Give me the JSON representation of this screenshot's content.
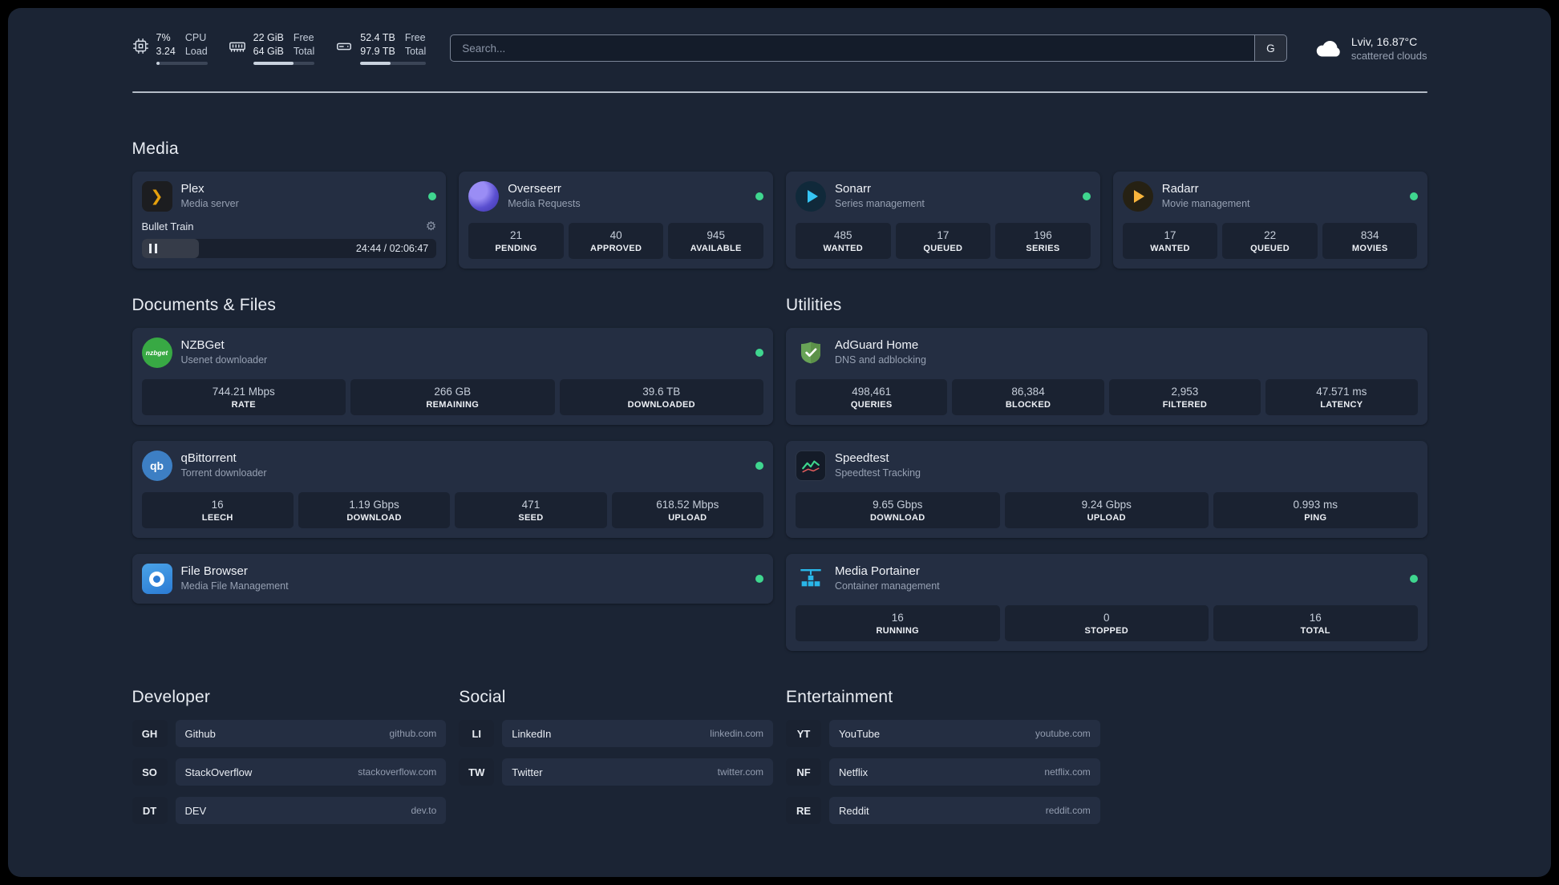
{
  "topbar": {
    "cpu": {
      "value1": "7%",
      "value2": "3.24",
      "label1": "CPU",
      "label2": "Load",
      "progress_pct": 7
    },
    "memory": {
      "value1": "22 GiB",
      "value2": "64 GiB",
      "label1": "Free",
      "label2": "Total",
      "progress_pct": 66
    },
    "disk": {
      "value1": "52.4 TB",
      "value2": "97.9 TB",
      "label1": "Free",
      "label2": "Total",
      "progress_pct": 46
    },
    "search": {
      "placeholder": "Search...",
      "provider_button": "G"
    },
    "weather": {
      "location": "Lviv, 16.87°C",
      "condition": "scattered clouds"
    }
  },
  "icons": {
    "cpu": "cpu-chip",
    "memory": "ram-stick",
    "disk": "hard-drive",
    "weather": "cloud",
    "settings": "gear",
    "playback": "pause",
    "plex": "plex-chevron",
    "overseerr": "overseerr-orb",
    "sonarr": "play-triangle-blue",
    "radarr": "play-triangle-yellow",
    "nzbget": "nzbget-badge",
    "qbittorrent": "qb-badge",
    "filebrowser": "filebrowser-disc",
    "adguard": "shield-check",
    "speedtest": "chart-line",
    "portainer": "container-crane"
  },
  "colors": {
    "online": "#3fd68f",
    "plex": "#e5a00d",
    "overseerr": "#5a4fd0",
    "sonarr": "#35c5f4",
    "radarr": "#f9b53c",
    "nzbget": "#38a944",
    "qbittorrent": "#3d7fc4",
    "filebrowser": "#2b7bd4",
    "adguard": "#68a357",
    "speedtest": "#3dd68c",
    "portainer": "#29b6e8"
  },
  "sections": {
    "media": {
      "title": "Media",
      "plex": {
        "name": "Plex",
        "subtitle": "Media server",
        "now_playing": {
          "title": "Bullet Train",
          "time": "24:44 / 02:06:47",
          "progress_pct": 19.5
        }
      },
      "overseerr": {
        "name": "Overseerr",
        "subtitle": "Media Requests",
        "stats": [
          {
            "value": "21",
            "label": "PENDING"
          },
          {
            "value": "40",
            "label": "APPROVED"
          },
          {
            "value": "945",
            "label": "AVAILABLE"
          }
        ]
      },
      "sonarr": {
        "name": "Sonarr",
        "subtitle": "Series management",
        "stats": [
          {
            "value": "485",
            "label": "WANTED"
          },
          {
            "value": "17",
            "label": "QUEUED"
          },
          {
            "value": "196",
            "label": "SERIES"
          }
        ]
      },
      "radarr": {
        "name": "Radarr",
        "subtitle": "Movie management",
        "stats": [
          {
            "value": "17",
            "label": "WANTED"
          },
          {
            "value": "22",
            "label": "QUEUED"
          },
          {
            "value": "834",
            "label": "MOVIES"
          }
        ]
      }
    },
    "files": {
      "title": "Documents & Files",
      "nzbget": {
        "name": "NZBGet",
        "subtitle": "Usenet downloader",
        "stats": [
          {
            "value": "744.21 Mbps",
            "label": "RATE"
          },
          {
            "value": "266 GB",
            "label": "REMAINING"
          },
          {
            "value": "39.6 TB",
            "label": "DOWNLOADED"
          }
        ]
      },
      "qbittorrent": {
        "name": "qBittorrent",
        "subtitle": "Torrent downloader",
        "stats": [
          {
            "value": "16",
            "label": "LEECH"
          },
          {
            "value": "1.19 Gbps",
            "label": "DOWNLOAD"
          },
          {
            "value": "471",
            "label": "SEED"
          },
          {
            "value": "618.52 Mbps",
            "label": "UPLOAD"
          }
        ]
      },
      "filebrowser": {
        "name": "File Browser",
        "subtitle": "Media File Management"
      }
    },
    "utilities": {
      "title": "Utilities",
      "adguard": {
        "name": "AdGuard Home",
        "subtitle": "DNS and adblocking",
        "stats": [
          {
            "value": "498,461",
            "label": "QUERIES"
          },
          {
            "value": "86,384",
            "label": "BLOCKED"
          },
          {
            "value": "2,953",
            "label": "FILTERED"
          },
          {
            "value": "47.571 ms",
            "label": "LATENCY"
          }
        ]
      },
      "speedtest": {
        "name": "Speedtest",
        "subtitle": "Speedtest Tracking",
        "stats": [
          {
            "value": "9.65 Gbps",
            "label": "DOWNLOAD"
          },
          {
            "value": "9.24 Gbps",
            "label": "UPLOAD"
          },
          {
            "value": "0.993 ms",
            "label": "PING"
          }
        ]
      },
      "portainer": {
        "name": "Media Portainer",
        "subtitle": "Container management",
        "stats": [
          {
            "value": "16",
            "label": "RUNNING"
          },
          {
            "value": "0",
            "label": "STOPPED"
          },
          {
            "value": "16",
            "label": "TOTAL"
          }
        ]
      }
    }
  },
  "bookmarks": {
    "developer": {
      "title": "Developer",
      "items": [
        {
          "abbr": "GH",
          "name": "Github",
          "url": "github.com"
        },
        {
          "abbr": "SO",
          "name": "StackOverflow",
          "url": "stackoverflow.com"
        },
        {
          "abbr": "DT",
          "name": "DEV",
          "url": "dev.to"
        }
      ]
    },
    "social": {
      "title": "Social",
      "items": [
        {
          "abbr": "LI",
          "name": "LinkedIn",
          "url": "linkedin.com"
        },
        {
          "abbr": "TW",
          "name": "Twitter",
          "url": "twitter.com"
        }
      ]
    },
    "entertainment": {
      "title": "Entertainment",
      "items": [
        {
          "abbr": "YT",
          "name": "YouTube",
          "url": "youtube.com"
        },
        {
          "abbr": "NF",
          "name": "Netflix",
          "url": "netflix.com"
        },
        {
          "abbr": "RE",
          "name": "Reddit",
          "url": "reddit.com"
        }
      ]
    }
  }
}
